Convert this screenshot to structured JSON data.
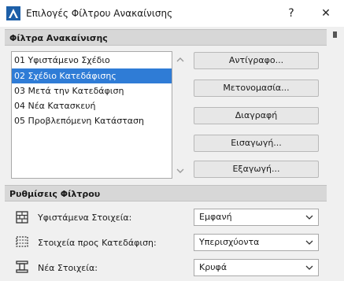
{
  "window": {
    "title": "Επιλογές Φίλτρου Ανακαίνισης",
    "help_label": "?",
    "close_label": "✕"
  },
  "filters_section": {
    "header": "Φίλτρα Ανακαίνισης",
    "items": [
      {
        "label": "01 Υφιστάμενο Σχέδιο",
        "selected": false
      },
      {
        "label": "02 Σχέδιο Κατεδάφισης",
        "selected": true
      },
      {
        "label": "03 Μετά την Κατεδάφιση",
        "selected": false
      },
      {
        "label": "04 Νέα Κατασκευή",
        "selected": false
      },
      {
        "label": "05 Προβλεπόμενη Κατάσταση",
        "selected": false
      }
    ],
    "buttons": {
      "copy": "Αντίγραφο...",
      "rename": "Μετονομασία...",
      "delete": "Διαγραφή",
      "import": "Εισαγωγή...",
      "export": "Εξαγωγή..."
    }
  },
  "settings_section": {
    "header": "Ρυθμίσεις Φίλτρου",
    "rows": [
      {
        "label": "Υφιστάμενα Στοιχεία:",
        "value": "Εμφανή",
        "icon": "existing-elements-icon"
      },
      {
        "label": "Στοιχεία προς Κατεδάφιση:",
        "value": "Υπερισχύοντα",
        "icon": "demolish-elements-icon"
      },
      {
        "label": "Νέα Στοιχεία:",
        "value": "Κρυφά",
        "icon": "new-elements-icon"
      }
    ]
  }
}
